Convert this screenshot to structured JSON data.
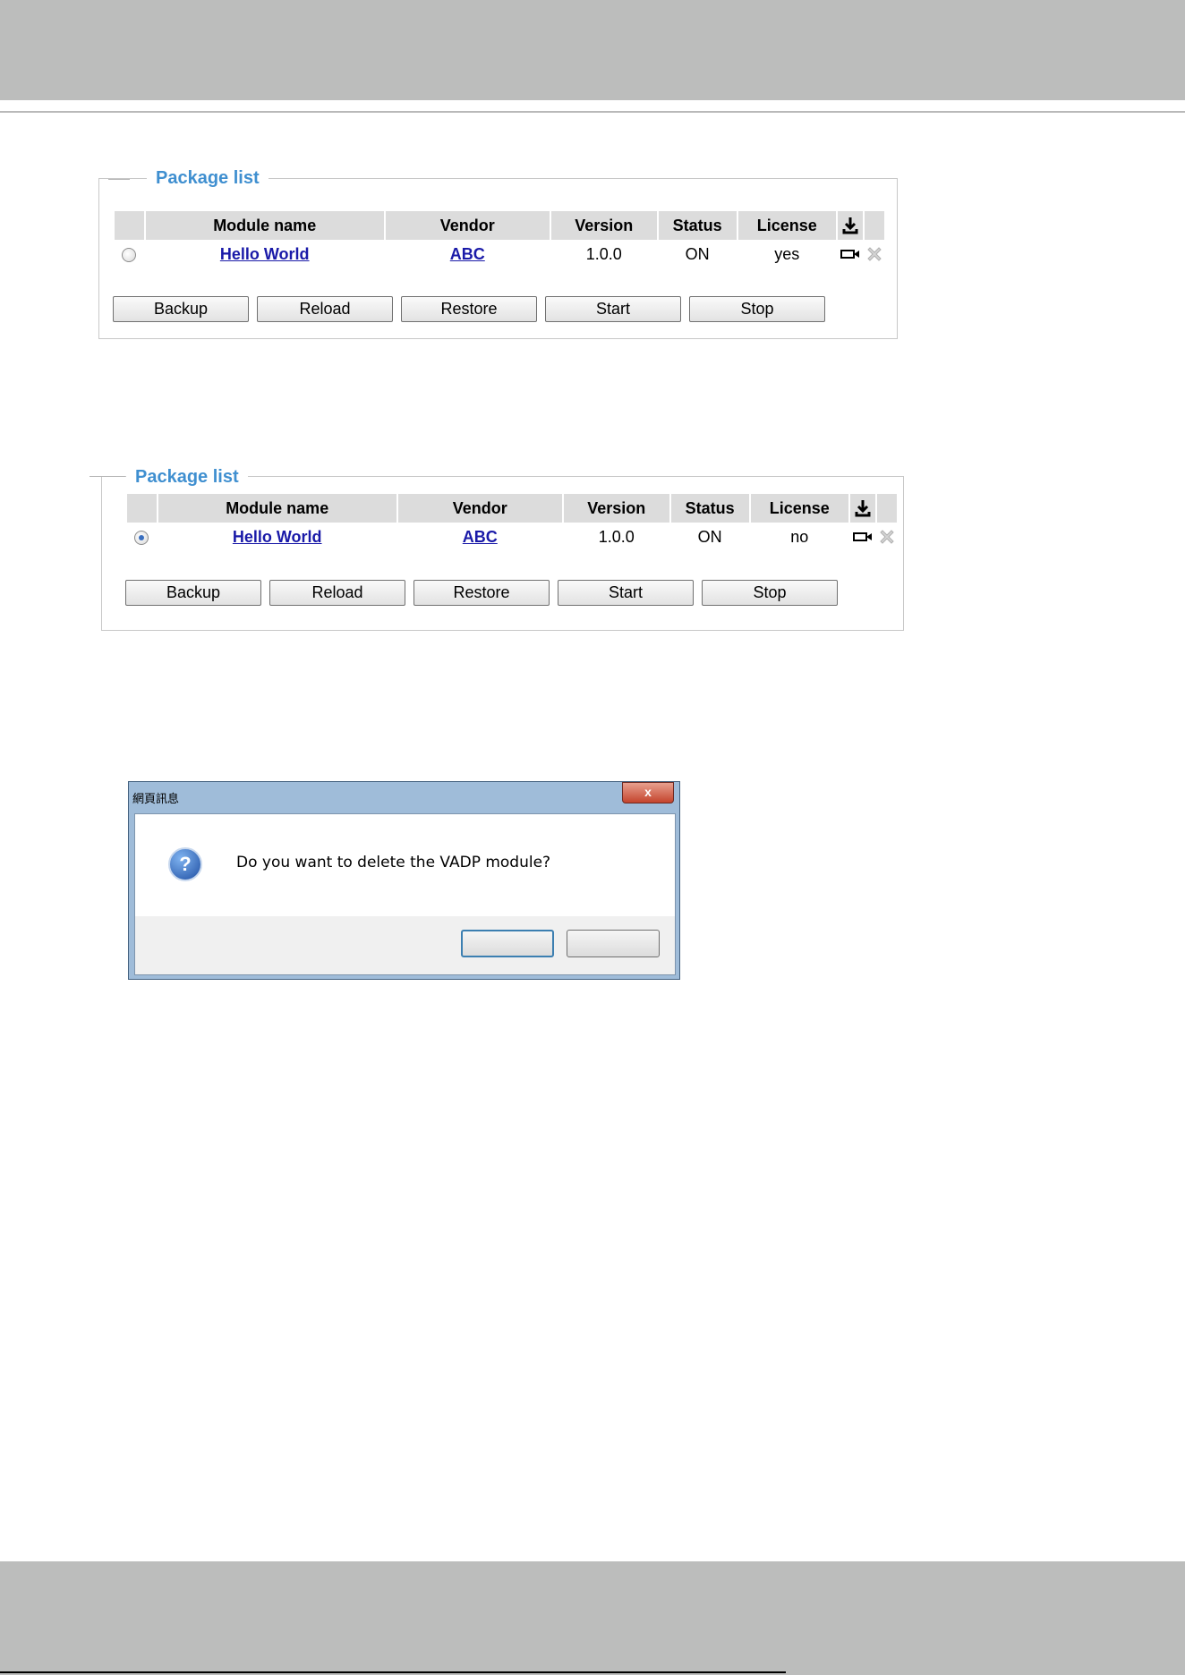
{
  "panels": [
    {
      "title": "Package list",
      "headers": [
        "Module name",
        "Vendor",
        "Version",
        "Status",
        "License"
      ],
      "row": {
        "selected": false,
        "module": "Hello World",
        "vendor": "ABC",
        "version": "1.0.0",
        "status": "ON",
        "license": "yes"
      },
      "buttons": [
        "Backup",
        "Reload",
        "Restore",
        "Start",
        "Stop"
      ]
    },
    {
      "title": "Package list",
      "headers": [
        "Module name",
        "Vendor",
        "Version",
        "Status",
        "License"
      ],
      "row": {
        "selected": true,
        "module": "Hello World",
        "vendor": "ABC",
        "version": "1.0.0",
        "status": "ON",
        "license": "no"
      },
      "buttons": [
        "Backup",
        "Reload",
        "Restore",
        "Start",
        "Stop"
      ]
    }
  ],
  "dialog": {
    "title": "網頁訊息",
    "close_label": "x",
    "message": "Do you want to delete the VADP module?",
    "icon": "question-icon"
  },
  "icons": [
    "download-icon",
    "camera-icon",
    "delete-icon",
    "question-icon"
  ],
  "colors": {
    "band": "#bcbdbc",
    "title_blue": "#3f8fd0",
    "link": "#1a1aa8"
  }
}
